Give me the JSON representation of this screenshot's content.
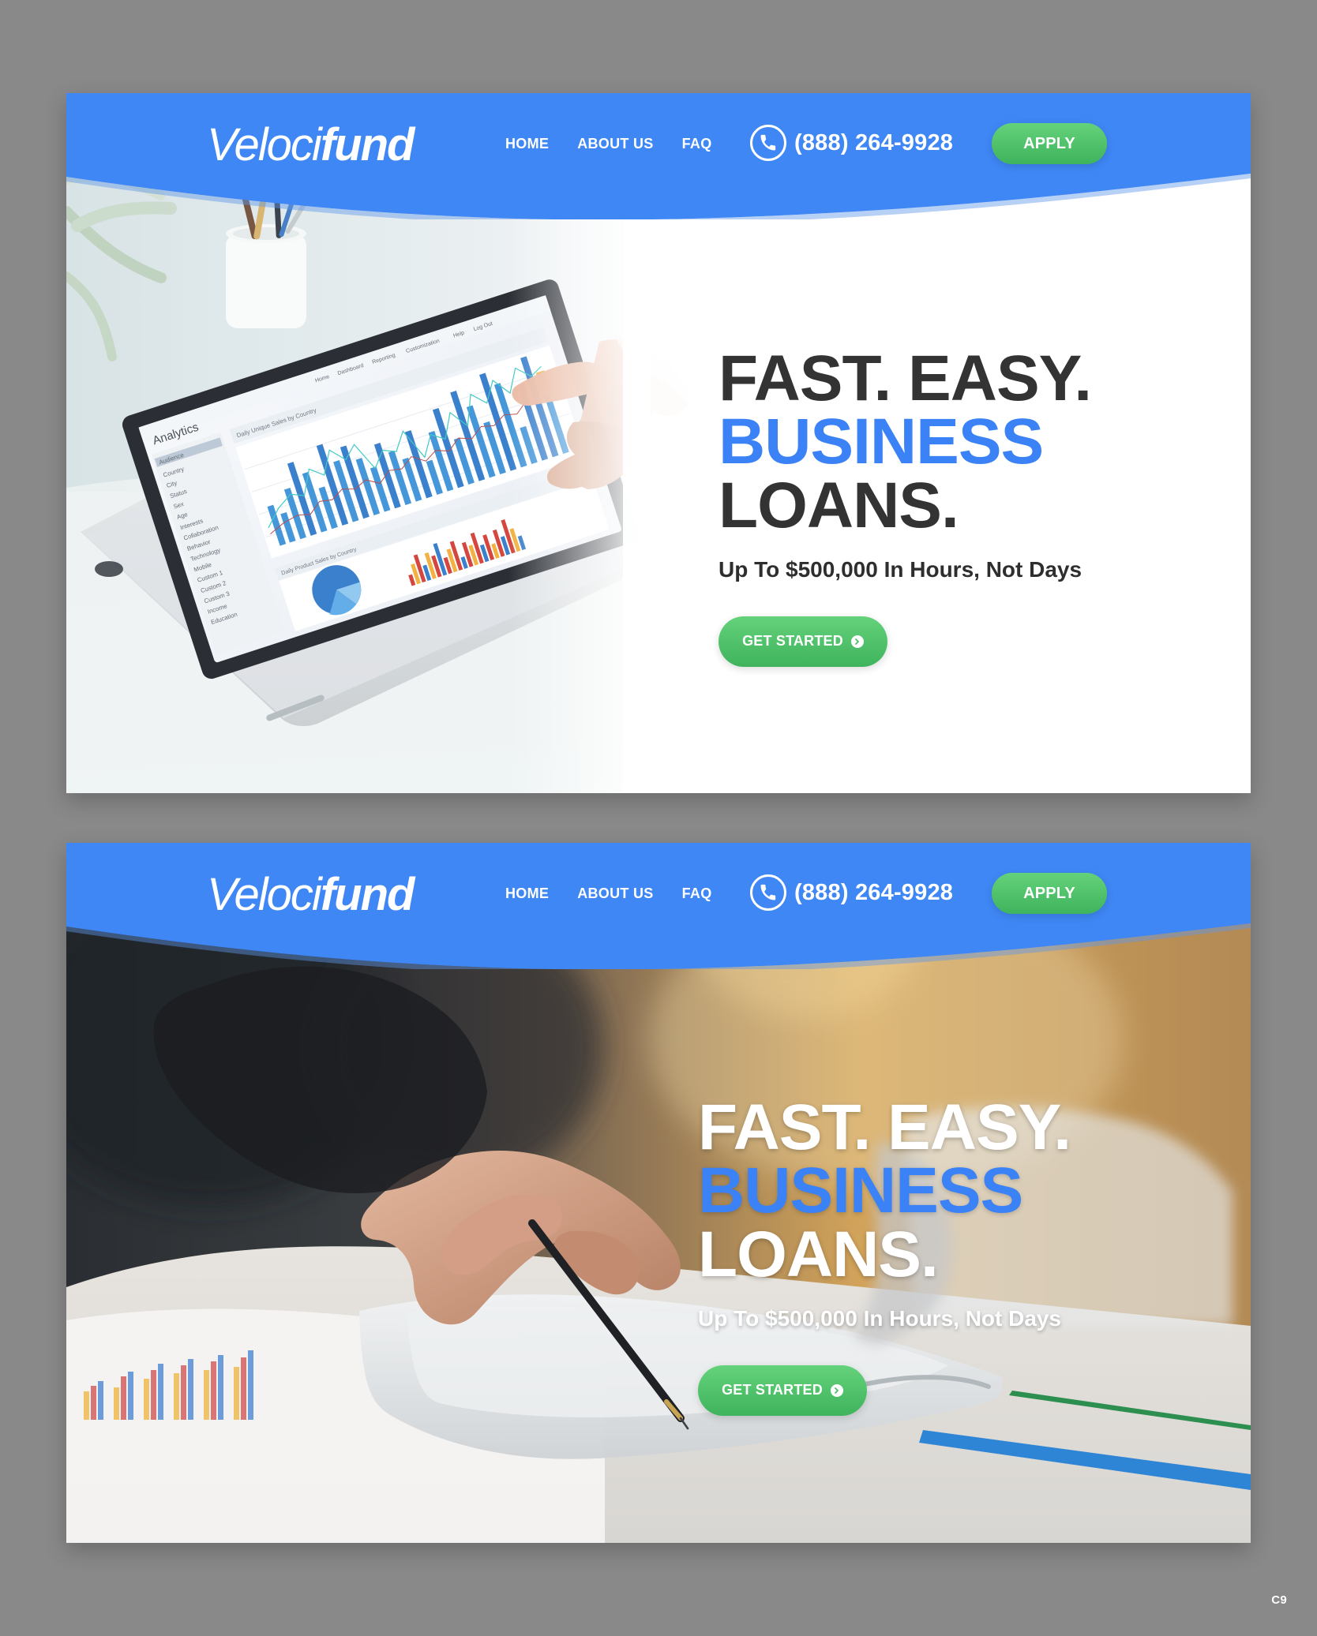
{
  "page": {
    "background": "#898989",
    "corner_label": "C9"
  },
  "colors": {
    "header_blue": "#3f87f5",
    "accent_blue": "#3b82f6",
    "green": "#4ac06a",
    "dark_text": "#333333",
    "white": "#ffffff"
  },
  "mockups": [
    {
      "brand": {
        "light": "Veloci",
        "bold": "fund"
      },
      "nav": {
        "home": "HOME",
        "about": "ABOUT US",
        "faq": "FAQ"
      },
      "phone": {
        "number": "(888) 264-9928",
        "icon": "phone-icon"
      },
      "apply_label": "APPLY",
      "hero": {
        "line1": "FAST. EASY.",
        "line2": "BUSINESS",
        "line3": "LOANS.",
        "subheading": "Up To $500,000 In Hours, Not Days",
        "cta": "GET STARTED",
        "cta_icon": "arrow-circle-right-icon"
      },
      "image": {
        "subject": "tablet-analytics-dashboard",
        "dashboard_title": "Analytics",
        "dashboard_sidebar": [
          "Audience",
          "Country",
          "City",
          "Status",
          "Sex",
          "Age",
          "Interests",
          "Collaboration",
          "Behavior",
          "Technology",
          "Mobile",
          "Custom 1",
          "Custom 2",
          "Custom 3",
          "Income",
          "Education"
        ],
        "dashboard_tabs": [
          "Home",
          "Dashboard",
          "Reporting",
          "Customization",
          "Help",
          "Log Out"
        ],
        "chart_title_1": "Daily Unique Sales by Country",
        "chart_title_2": "Daily Product Sales by Country"
      }
    },
    {
      "brand": {
        "light": "Veloci",
        "bold": "fund"
      },
      "nav": {
        "home": "HOME",
        "about": "ABOUT US",
        "faq": "FAQ"
      },
      "phone": {
        "number": "(888) 264-9928",
        "icon": "phone-icon"
      },
      "apply_label": "APPLY",
      "hero": {
        "line1": "FAST. EASY.",
        "line2": "BUSINESS",
        "line3": "LOANS.",
        "subheading": "Up To $500,000 In Hours, Not Days",
        "cta": "GET STARTED",
        "cta_icon": "arrow-circle-right-icon"
      },
      "image": {
        "subject": "hand-pen-documents-desk"
      }
    }
  ]
}
